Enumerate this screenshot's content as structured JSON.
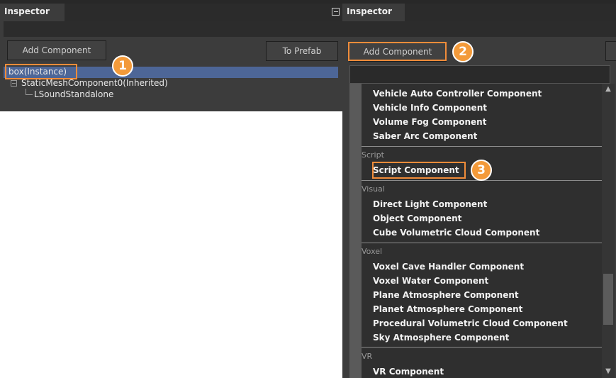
{
  "left": {
    "tab_title": "Inspector",
    "add_component": "Add Component",
    "to_prefab": "To Prefab",
    "tree": [
      "box(Instance)",
      "StaticMeshComponent0(Inherited)",
      "LSoundStandalone"
    ]
  },
  "right": {
    "tab_title": "Inspector",
    "add_component": "Add Component",
    "groups": [
      {
        "section": "",
        "items": [
          "Vehicle Auto Controller Component",
          "Vehicle Info Component",
          "Volume Fog Component",
          "Saber Arc Component"
        ]
      },
      {
        "section": "Script",
        "items": [
          "Script Component"
        ]
      },
      {
        "section": "Visual",
        "items": [
          "Direct Light Component",
          "Object Component",
          "Cube Volumetric Cloud Component"
        ]
      },
      {
        "section": "Voxel",
        "items": [
          "Voxel Cave Handler Component",
          "Voxel Water Component",
          "Plane Atmosphere Component",
          "Planet Atmosphere Component",
          "Procedural Volumetric Cloud Component",
          "Sky Atmosphere Component"
        ]
      },
      {
        "section": "VR",
        "items": [
          "VR Component"
        ]
      }
    ]
  },
  "badges": [
    "1",
    "2",
    "3"
  ],
  "colors": {
    "highlight": "#f08c3a",
    "badge": "#f39a3a",
    "selection": "#4d6697",
    "panel": "#3c3c3c"
  }
}
